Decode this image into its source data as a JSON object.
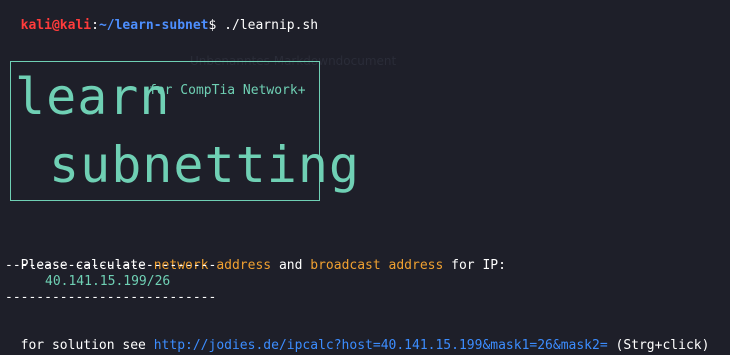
{
  "prompt": {
    "user_host": "kali@kali",
    "sep": ":",
    "cwd": "~/learn-subnet",
    "dollar": "$",
    "command": " ./learnip.sh"
  },
  "ghost_text": "Unbenanntes Markdowndocument",
  "banner": {
    "word1": "learn",
    "word2": "subnetting",
    "subtitle": "for CompTia Network+"
  },
  "question": {
    "prefix": "Please calculate ",
    "term1": "network address",
    "and": " and ",
    "term2": "broadcast address",
    "suffix": " for IP:"
  },
  "divider": "---------------------------",
  "ip": "40.141.15.199/26",
  "solution": {
    "prefix": "for solution see ",
    "url": "http://jodies.de/ipcalc?host=40.141.15.199&mask1=26&mask2=",
    "hint": " (Strg+click)"
  },
  "colors": {
    "background": "#1e1f29",
    "user": "#ff3b3b",
    "path": "#4d8fff",
    "accent_orange": "#f0a030",
    "teal": "#6fd0b4",
    "link": "#3c8dff"
  }
}
